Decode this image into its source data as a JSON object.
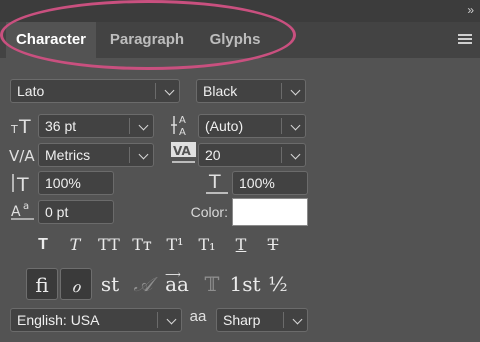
{
  "panel": {
    "collapse_glyph": "»",
    "menu_icon": "hamburger-menu-icon",
    "tabs": [
      {
        "label": "Character"
      },
      {
        "label": "Paragraph"
      },
      {
        "label": "Glyphs"
      }
    ]
  },
  "font": {
    "family": "Lato",
    "style": "Black"
  },
  "size": {
    "font_size": "36 pt",
    "leading": "(Auto)",
    "kerning": "Metrics",
    "tracking": "20",
    "vertical_scale": "100%",
    "horizontal_scale": "100%",
    "baseline_shift": "0 pt"
  },
  "color": {
    "label": "Color:",
    "swatch": "#ffffff"
  },
  "style_buttons": [
    {
      "glyph": "T",
      "name": "faux-bold"
    },
    {
      "glyph": "T",
      "name": "faux-italic"
    },
    {
      "glyph": "TT",
      "name": "all-caps"
    },
    {
      "glyph": "Tᴛ",
      "name": "small-caps"
    },
    {
      "glyph": "T¹",
      "name": "superscript"
    },
    {
      "glyph": "T₁",
      "name": "subscript"
    },
    {
      "glyph": "T",
      "name": "underline"
    },
    {
      "glyph": "T",
      "name": "strikethrough"
    }
  ],
  "opentype_buttons": [
    {
      "glyph": "fi",
      "name": "ligatures"
    },
    {
      "glyph": "ℴ",
      "name": "contextual-alternates"
    },
    {
      "glyph": "st",
      "name": "discretionary-ligatures"
    },
    {
      "glyph": "𝒜",
      "name": "swash"
    },
    {
      "glyph": "aa",
      "name": "stylistic-alternates"
    },
    {
      "glyph": "𝕋",
      "name": "titling-alternates"
    },
    {
      "glyph": "1st",
      "name": "ordinals"
    },
    {
      "glyph": "½",
      "name": "fractions"
    }
  ],
  "bottom": {
    "language": "English: USA",
    "antialias_icon": "aa",
    "antialias": "Sharp"
  },
  "colors": {
    "panel_bg": "#535353",
    "tab_bar_bg": "#434343",
    "highlight": "#c9507f"
  }
}
